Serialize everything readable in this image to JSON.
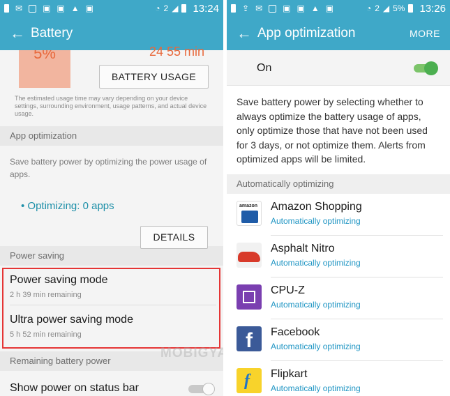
{
  "left": {
    "status": {
      "sim": "2",
      "time": "13:24"
    },
    "appbar": {
      "title": "Battery"
    },
    "usage": {
      "percent_partial": "5%",
      "remaining_partial": "24 55 min",
      "button_label": "BATTERY USAGE",
      "note": "The estimated usage time may vary depending on your device settings, surrounding environment, usage patterns, and actual device usage."
    },
    "app_optimization": {
      "header": "App optimization",
      "description": "Save battery power by optimizing the power usage of apps.",
      "status": "• Optimizing: 0 apps",
      "details_label": "DETAILS"
    },
    "power_saving": {
      "header": "Power saving",
      "items": [
        {
          "title": "Power saving mode",
          "subtitle": "2 h 39 min remaining"
        },
        {
          "title": "Ultra power saving mode",
          "subtitle": "5 h 52 min remaining"
        }
      ]
    },
    "remaining": {
      "header": "Remaining battery power",
      "toggle_label": "Show power on status bar",
      "toggle_on": false
    },
    "watermark": "MOBIGYAAN"
  },
  "right": {
    "status": {
      "sim": "2",
      "battery": "5%",
      "time": "13:26"
    },
    "appbar": {
      "title": "App optimization",
      "more": "MORE"
    },
    "master_toggle": {
      "label": "On",
      "on": true
    },
    "description": "Save battery power by selecting whether to always optimize the battery usage of apps, only optimize those that have not been used for 3 days, or not optimize them. Alerts from optimized apps will be limited.",
    "section_header": "Automatically optimizing",
    "apps": [
      {
        "name": "Amazon Shopping",
        "status": "Automatically optimizing",
        "icon": "amazon-icon",
        "icon_text": "amazon"
      },
      {
        "name": "Asphalt Nitro",
        "status": "Automatically optimizing",
        "icon": "asphalt-icon"
      },
      {
        "name": "CPU-Z",
        "status": "Automatically optimizing",
        "icon": "cpuz-icon"
      },
      {
        "name": "Facebook",
        "status": "Automatically optimizing",
        "icon": "facebook-icon",
        "icon_text": "f"
      },
      {
        "name": "Flipkart",
        "status": "Automatically optimizing",
        "icon": "flipkart-icon",
        "icon_text": "f"
      }
    ]
  },
  "colors": {
    "appbar": "#3fa8c8",
    "accent_text": "#1d8fa8",
    "link": "#2196c4",
    "highlight_box": "#e53535",
    "toggle_on": "#4caf50",
    "battery_orange": "#e8693c"
  }
}
